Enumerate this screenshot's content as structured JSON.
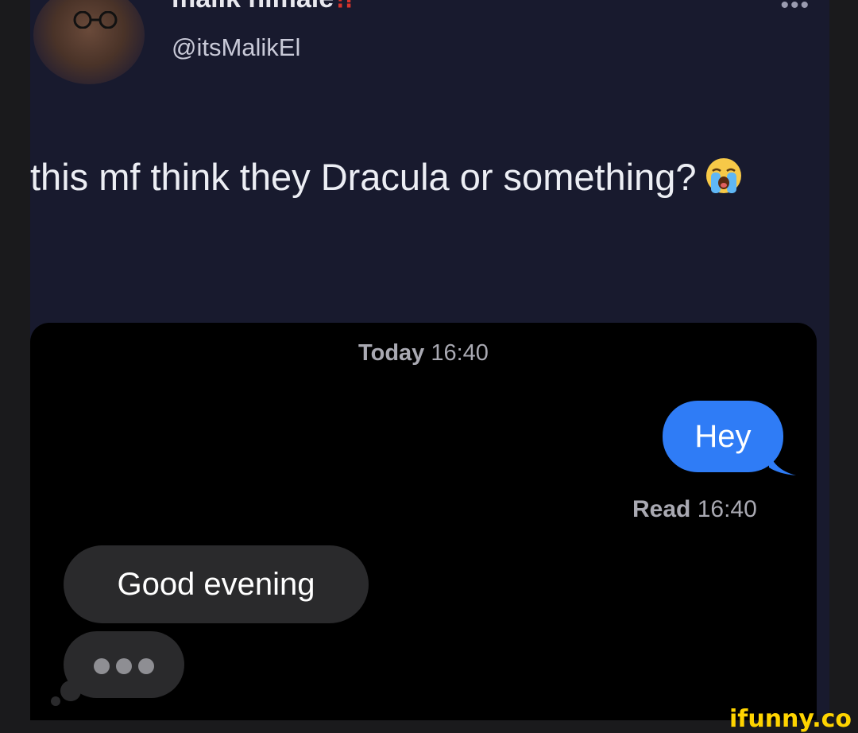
{
  "tweet": {
    "display_name": "malik himale",
    "name_emoji": "⁉",
    "handle": "@itsMalikEl",
    "more_icon": "more-horizontal-icon",
    "text": "this mf think they Dracula or something?",
    "text_emoji": "loudly-crying-face"
  },
  "chat": {
    "timestamp_day": "Today",
    "timestamp_time": "16:40",
    "sent_message": "Hey",
    "read_label": "Read",
    "read_time": "16:40",
    "received_message": "Good evening",
    "typing_indicator": "typing-dots-icon"
  },
  "colors": {
    "tweet_background": "#181a2e",
    "chat_background": "#000000",
    "sent_bubble": "#2f7cf6",
    "received_bubble": "#2a2a2c",
    "watermark": "#ffd400"
  },
  "watermark": "ifunny.co"
}
